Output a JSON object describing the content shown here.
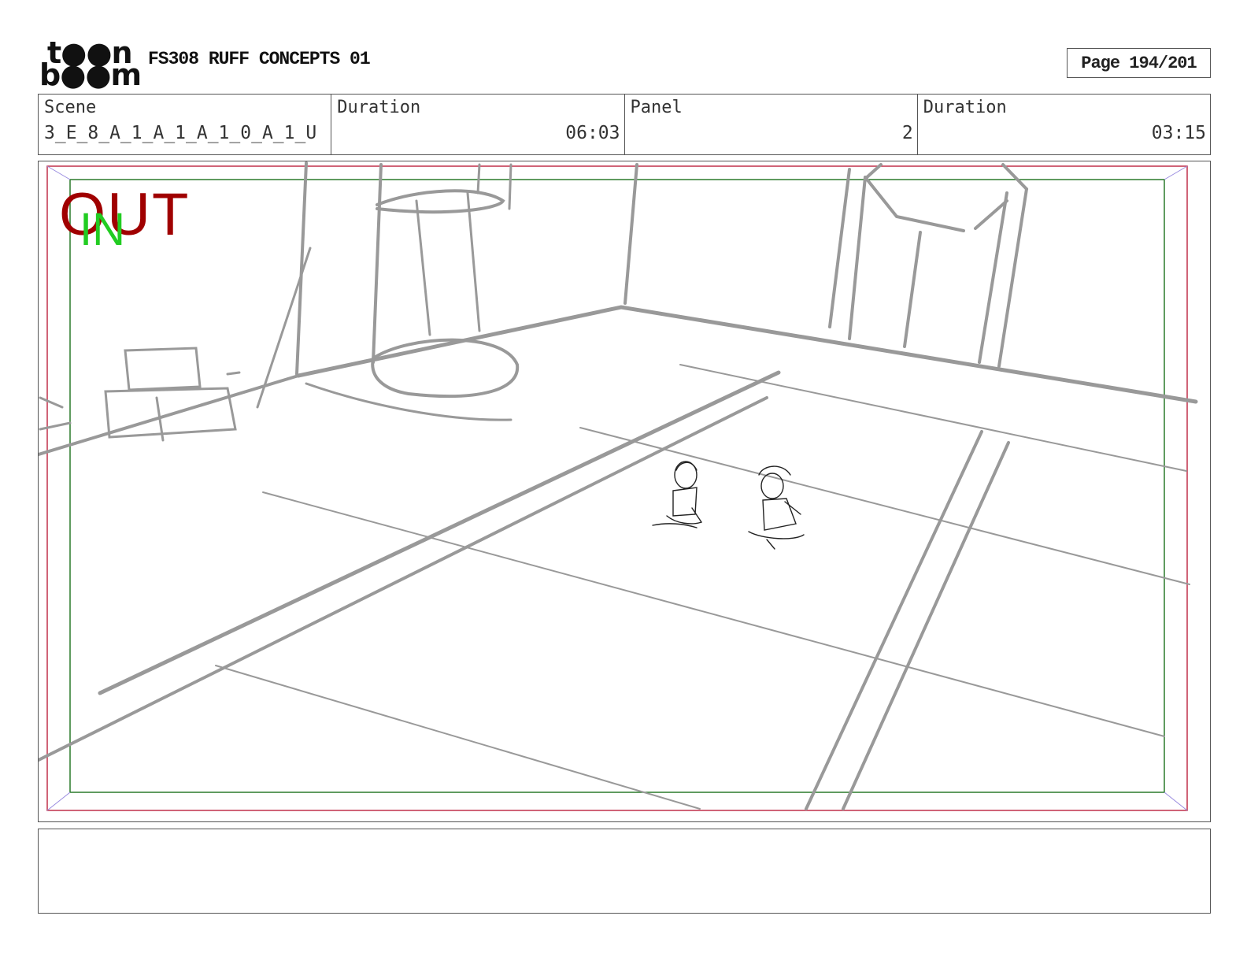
{
  "header": {
    "logo_line1": "t●●n",
    "logo_line2": "b●●m",
    "title": "FS308 RUFF CONCEPTS 01",
    "page_label": "Page 194/201"
  },
  "info": {
    "scene_label": "Scene",
    "scene_value": "3_E_8_A_1_A_1_A_1_0_A_1_U",
    "duration_label": "Duration",
    "duration_value": "06:03",
    "panel_label": "Panel",
    "panel_value": "2",
    "panel_duration_label": "Duration",
    "panel_duration_value": "03:15"
  },
  "frame": {
    "out_label": "OUT",
    "in_label": "IN",
    "colors": {
      "out": "#a00000",
      "in": "#22cc22",
      "sketch": "#999999"
    }
  },
  "notes": {
    "text": ""
  }
}
